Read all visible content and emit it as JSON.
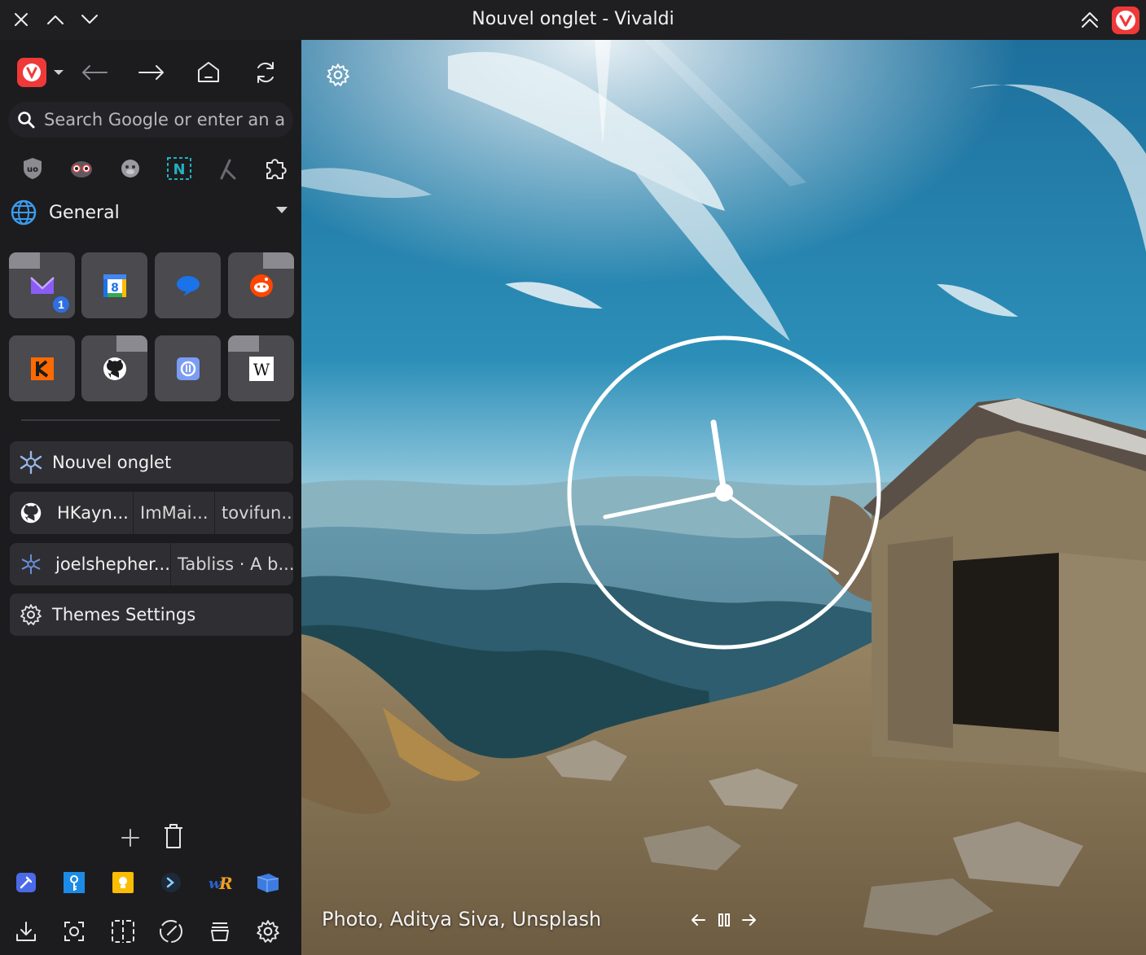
{
  "window": {
    "title": "Nouvel onglet - Vivaldi"
  },
  "search": {
    "placeholder": "Search Google or enter an a..."
  },
  "extensions": [
    "ublock-origin",
    "privacy-badger",
    "monkey-script",
    "notion-web-clipper",
    "link-tool",
    "extensions-puzzle"
  ],
  "workspace": {
    "label": "General"
  },
  "speed_dial": [
    {
      "name": "mail",
      "badge": "1"
    },
    {
      "name": "google-calendar",
      "badge": "8"
    },
    {
      "name": "messages"
    },
    {
      "name": "reddit"
    },
    {
      "name": "kagi"
    },
    {
      "name": "github"
    },
    {
      "name": "proton"
    },
    {
      "name": "wikipedia",
      "glyph": "W"
    }
  ],
  "tabs": [
    {
      "label": "Nouvel onglet"
    },
    {
      "stack": [
        "HKayn...",
        "ImMai...",
        "tovifun..."
      ]
    },
    {
      "stack": [
        "joelshepher...",
        "Tabliss · A b..."
      ]
    },
    {
      "label": "Themes Settings"
    }
  ],
  "credit": "Photo, Aditya Siva, Unsplash",
  "colors": {
    "vivaldi_red": "#ef3939",
    "sidebar_bg": "#1c1c1f",
    "tab_bg": "#2f2f33",
    "tile_bg": "#4a4a4f",
    "badge_blue": "#2f6fe0"
  }
}
